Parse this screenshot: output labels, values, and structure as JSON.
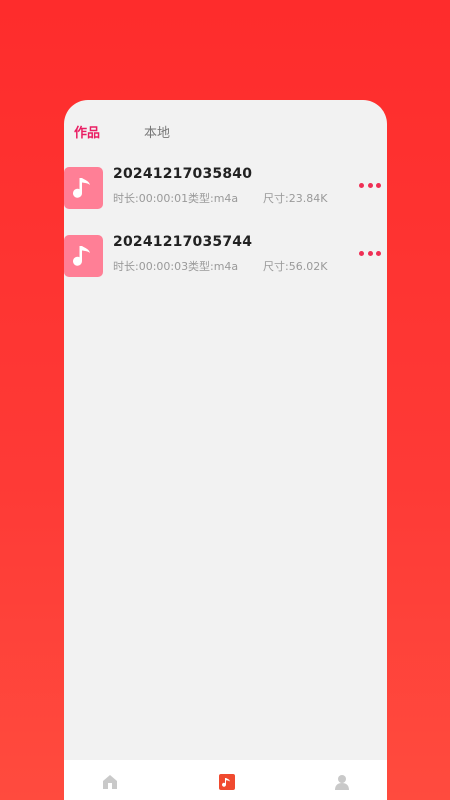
{
  "tabs": [
    {
      "label": "作品",
      "active": true
    },
    {
      "label": "本地",
      "active": false
    }
  ],
  "files": [
    {
      "title": "20241217035840",
      "duration": "时长:00:00:01",
      "type": "类型:m4a",
      "size": "尺寸:23.84K"
    },
    {
      "title": "20241217035744",
      "duration": "时长:00:00:03",
      "type": "类型:m4a",
      "size": "尺寸:56.02K"
    }
  ],
  "icons": {
    "file": "music-note-icon",
    "more": "more-dots-icon",
    "nav_home": "home-icon",
    "nav_music": "music-icon",
    "nav_user": "user-icon"
  },
  "colors": {
    "accent": "#e91e63",
    "file_icon_bg": "#ff7f96",
    "dots": "#ef2f55"
  },
  "bottom_nav": {
    "active": "music"
  }
}
